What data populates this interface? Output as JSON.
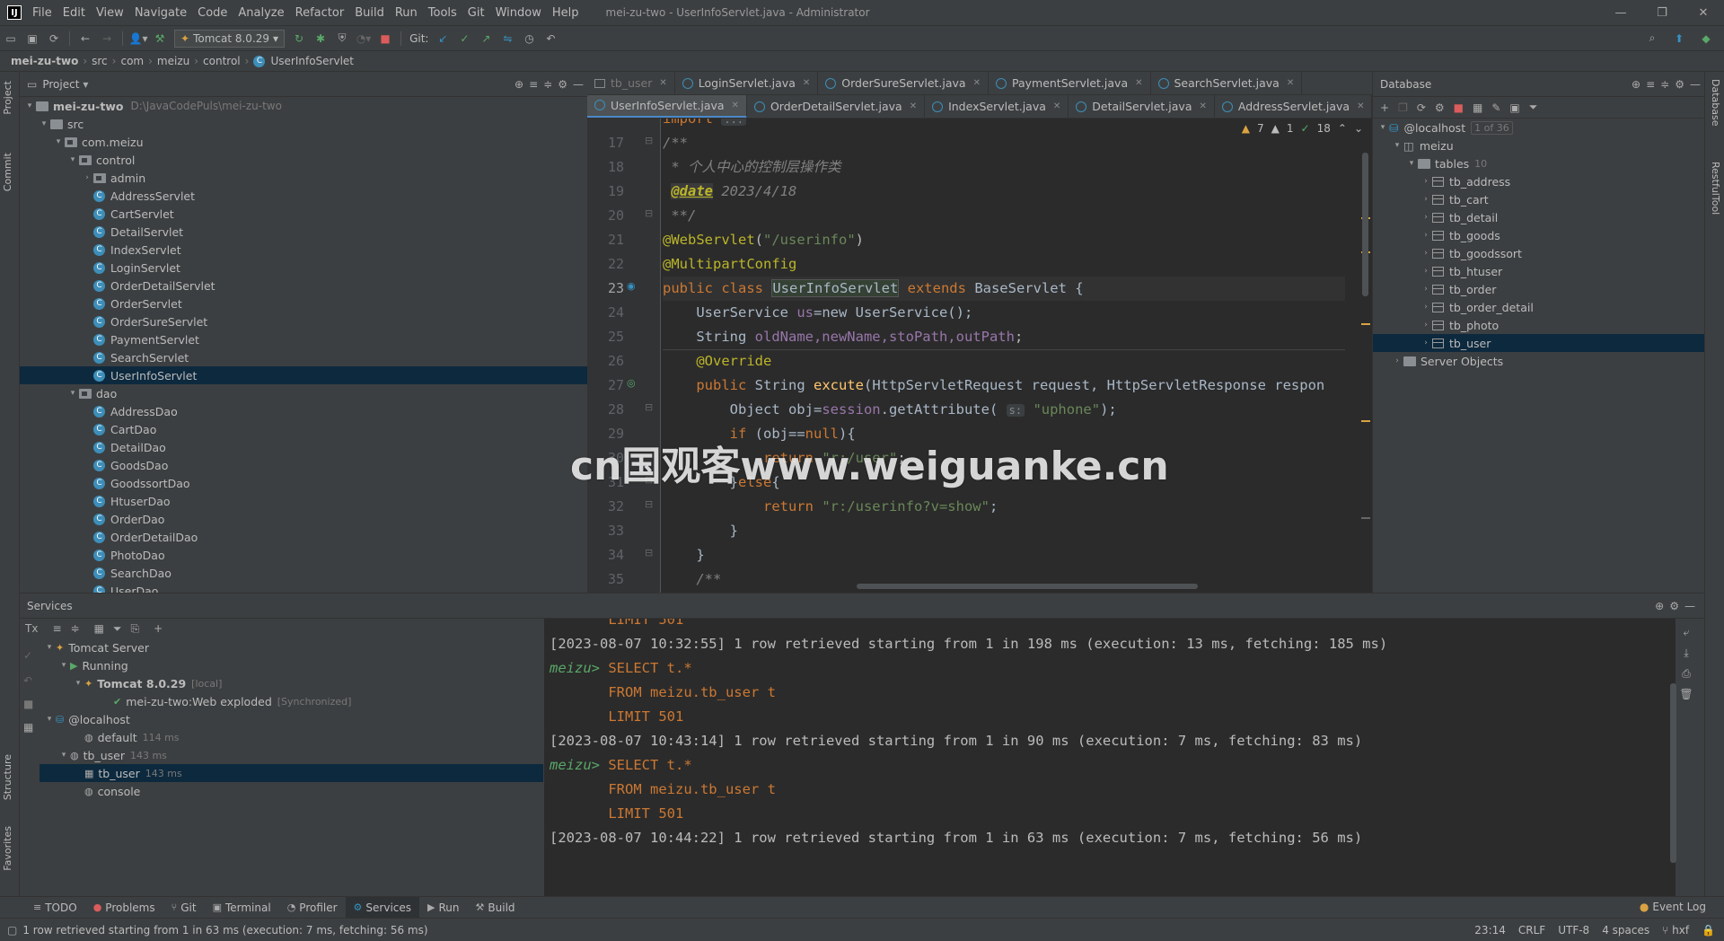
{
  "app": {
    "logo": "IJ",
    "window_title": "mei-zu-two - UserInfoServlet.java - Administrator"
  },
  "menu": [
    "File",
    "Edit",
    "View",
    "Navigate",
    "Code",
    "Analyze",
    "Refactor",
    "Build",
    "Run",
    "Tools",
    "Git",
    "Window",
    "Help"
  ],
  "toolbar": {
    "run_config": "Tomcat 8.0.29",
    "git_label": "Git:"
  },
  "breadcrumb": [
    "mei-zu-two",
    "src",
    "com",
    "meizu",
    "control",
    "UserInfoServlet"
  ],
  "project": {
    "title": "Project",
    "root": "mei-zu-two",
    "root_path": "D:\\JavaCodePuls\\mei-zu-two",
    "src": "src",
    "pkg": "com.meizu",
    "control": "control",
    "admin": "admin",
    "control_classes": [
      "AddressServlet",
      "CartServlet",
      "DetailServlet",
      "IndexServlet",
      "LoginServlet",
      "OrderDetailServlet",
      "OrderServlet",
      "OrderSureServlet",
      "PaymentServlet",
      "SearchServlet",
      "UserInfoServlet"
    ],
    "dao": "dao",
    "dao_classes": [
      "AddressDao",
      "CartDao",
      "DetailDao",
      "GoodsDao",
      "GoodssortDao",
      "HtuserDao",
      "OrderDao",
      "OrderDetailDao",
      "PhotoDao",
      "SearchDao",
      "UserDao"
    ]
  },
  "editor": {
    "tabs_row1": [
      "tb_user",
      "LoginServlet.java",
      "OrderSureServlet.java",
      "PaymentServlet.java",
      "SearchServlet.java"
    ],
    "tabs_row2": [
      "UserInfoServlet.java",
      "OrderDetailServlet.java",
      "IndexServlet.java",
      "DetailServlet.java",
      "AddressServlet.java"
    ],
    "inspections": {
      "warnings": "7",
      "weak": "1",
      "ok": "18"
    },
    "top_fold": "import",
    "top_fold_hint": "...",
    "line_numbers": [
      "17",
      "18",
      "19",
      "20",
      "21",
      "22",
      "23",
      "24",
      "25",
      "26",
      "27",
      "28",
      "29",
      "30",
      "31",
      "32",
      "33",
      "34",
      "35"
    ],
    "code": {
      "l17": "/**",
      "l18": " * 个人中心的控制层操作类",
      "l19_tag": "@date",
      "l19_val": " 2023/4/18",
      "l20": " **/",
      "l21_ann": "@WebServlet",
      "l21_str": "\"/userinfo\"",
      "l22_ann": "@MultipartConfig",
      "l23_kw": "public class ",
      "l23_name": "UserInfoServlet",
      "l23_ext": " extends ",
      "l23_base": "BaseServlet {",
      "l24_type": "UserService ",
      "l24_field": "us",
      "l24_rest": "=new UserService();",
      "l25_type": "String ",
      "l25_fields": "oldName,newName,stoPath,outPath",
      "l26": "@Override",
      "l27_kw": "public ",
      "l27_ret": "String ",
      "l27_fn": "excute",
      "l27_params": "(HttpServletRequest request, HttpServletResponse respon",
      "l28_a": "Object obj=",
      "l28_b": "session",
      "l28_c": ".getAttribute(",
      "l28_hint": "s:",
      "l28_str": "\"uphone\"",
      "l28_d": ");",
      "l29_kw": "if",
      "l29_rest": " (obj==",
      "l29_null": "null",
      "l29_end": "){",
      "l30_kw": "return ",
      "l30_str": "\"r:/user\"",
      "l31_a": "}",
      "l31_kw": "else",
      "l31_b": "{",
      "l32_kw": "return ",
      "l32_str": "\"r:/userinfo?v=show\"",
      "l32_end": ";",
      "l33": "}",
      "l34": "}",
      "l35": "/**"
    }
  },
  "database": {
    "title": "Database",
    "host": "@localhost",
    "host_badge": "1 of 36",
    "schema": "meizu",
    "tables_label": "tables",
    "tables_count": "10",
    "tables": [
      "tb_address",
      "tb_cart",
      "tb_detail",
      "tb_goods",
      "tb_goodssort",
      "tb_htuser",
      "tb_order",
      "tb_order_detail",
      "tb_photo",
      "tb_user"
    ],
    "server_objects": "Server Objects"
  },
  "services": {
    "title": "Services",
    "tomcat_server": "Tomcat Server",
    "running": "Running",
    "tomcat": "Tomcat 8.0.29",
    "tomcat_local": "[local]",
    "artifact": "mei-zu-two:Web exploded",
    "artifact_state": "[Synchronized]",
    "localhost": "@localhost",
    "default": "default",
    "default_ms": "114 ms",
    "tb_user": "tb_user",
    "tb_user_ms": "143 ms",
    "tb_user_child": "tb_user",
    "tb_user_child_ms": "143 ms",
    "console": "console"
  },
  "console": {
    "top_cut": "LIMIT 501",
    "line1": "[2023-08-07 10:32:55] 1 row retrieved starting from 1 in 198 ms (execution: 13 ms, fetching: 185 ms)",
    "prompt": "meizu>",
    "select": "SELECT t.*",
    "from": "FROM meizu.tb_user t",
    "limit": "LIMIT 501",
    "line2": "[2023-08-07 10:43:14] 1 row retrieved starting from 1 in 90 ms (execution: 7 ms, fetching: 83 ms)",
    "line3": "[2023-08-07 10:44:22] 1 row retrieved starting from 1 in 63 ms (execution: 7 ms, fetching: 56 ms)"
  },
  "bottom_tabs": [
    "TODO",
    "Problems",
    "Git",
    "Terminal",
    "Profiler",
    "Services",
    "Run",
    "Build"
  ],
  "event_log": "Event Log",
  "status": {
    "message": "1 row retrieved starting from 1 in 63 ms (execution: 7 ms, fetching: 56 ms)",
    "position": "23:14",
    "line_sep": "CRLF",
    "encoding": "UTF-8",
    "indent": "4 spaces",
    "vcs": "hxf"
  },
  "strips": {
    "project": "Project",
    "commit": "Commit",
    "structure": "Structure",
    "favorites": "Favorites",
    "database": "Database",
    "restful": "RestfulTool"
  },
  "watermark": "cn国观客www.weiguanke.cn"
}
